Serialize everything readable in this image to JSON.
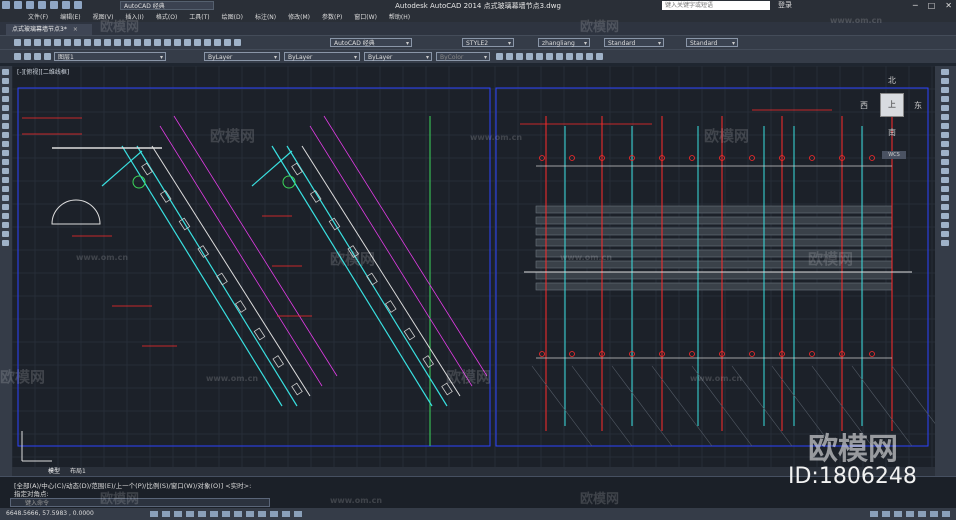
{
  "titlebar": {
    "workspace": "AutoCAD 经典",
    "app_title": "Autodesk AutoCAD 2014    点式玻璃幕墙节点3.dwg",
    "search_placeholder": "键入关键字或短语",
    "login": "登录"
  },
  "menu": [
    "文件(F)",
    "编辑(E)",
    "视图(V)",
    "插入(I)",
    "格式(O)",
    "工具(T)",
    "绘图(D)",
    "标注(N)",
    "修改(M)",
    "参数(P)",
    "窗口(W)",
    "帮助(H)"
  ],
  "doc_tab": {
    "label": "点式玻璃幕墙节点3*"
  },
  "toolbar1": {
    "workspace": "AutoCAD 经典",
    "text_style": "STYLE2",
    "dim_style": "zhangliang",
    "table_style": "Standard",
    "multileader_style": "Standard"
  },
  "toolbar2": {
    "layer": "图层1",
    "color": "ByLayer",
    "linetype": "ByLayer",
    "lineweight": "ByLayer",
    "plotstyle": "ByColor"
  },
  "viewport_label": "[-][俯视][二维线框]",
  "layout_tabs": [
    "模型",
    "布局1"
  ],
  "command": {
    "line1": "[全部(A)/中心(C)/动态(D)/范围(E)/上一个(P)/比例(S)/窗口(W)/对象(O)] <实时>:",
    "line2": "指定对角点:",
    "input_placeholder": "键入命令"
  },
  "status": {
    "coords": "6648.5666, 57.5983 , 0.0000"
  },
  "compass": {
    "north": "北",
    "south": "南",
    "east": "东",
    "west": "西",
    "top": "上",
    "ucs": "WCS"
  },
  "watermark": {
    "site": "www.om.cn",
    "brand": "欧模网",
    "id": "ID:1806248"
  },
  "colors": {
    "bg": "#1c2129",
    "red": "#ff2a2a",
    "cyan": "#39e0e0",
    "green": "#3cd65a",
    "blue_frame": "#2b42ff",
    "magenta": "#e23ce6"
  }
}
